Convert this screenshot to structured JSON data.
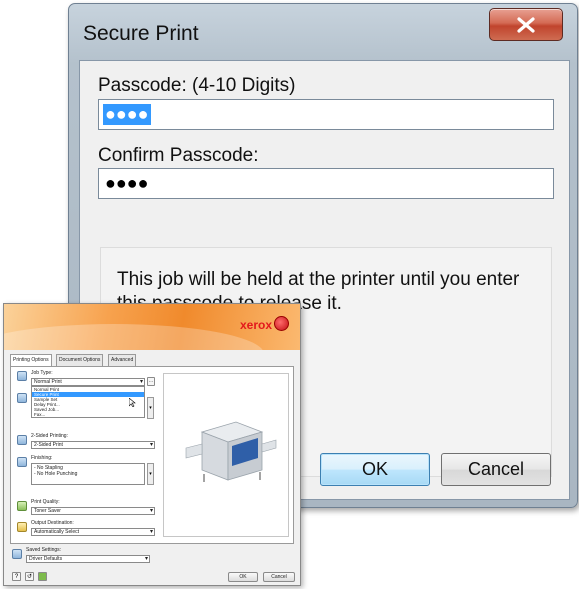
{
  "dialog": {
    "title": "Secure Print",
    "close_icon": "close-x-icon",
    "passcode_label": "Passcode: (4-10 Digits)",
    "passcode_value": "●●●●",
    "confirm_label": "Confirm Passcode:",
    "confirm_value": "●●●●",
    "note": "This job will be held at the printer until you enter this passcode to release it.",
    "ok_label": "OK",
    "cancel_label": "Cancel"
  },
  "driver": {
    "brand": "xerox",
    "tabs": [
      "Printing Options",
      "Document Options",
      "Advanced"
    ],
    "job_type": {
      "label": "Job Type:",
      "selected": "Normal Print",
      "options": [
        "Normal Print",
        "Secure Print",
        "Sample Set",
        "Delay Print...",
        "Saved Job...",
        "Fax..."
      ]
    },
    "two_sided": {
      "label": "2-Sided Printing:",
      "value": "2-Sided Print"
    },
    "finishing": {
      "label": "Finishing:",
      "items": [
        "- No Stapling",
        "- No Hole Punching"
      ]
    },
    "quality": {
      "label": "Print Quality:",
      "value": "Toner Saver"
    },
    "output": {
      "label": "Output Destination:",
      "value": "Automatically Select"
    },
    "saved": {
      "label": "Saved Settings:",
      "value": "Driver Defaults"
    },
    "bottom_icons": [
      "?",
      "↺"
    ],
    "ok_label": "OK",
    "cancel_label": "Cancel"
  },
  "colors": {
    "selection": "#3399ff",
    "close_button": "#c7432c",
    "xerox_red": "#e3191c",
    "banner_orange": "#f08a2c"
  }
}
